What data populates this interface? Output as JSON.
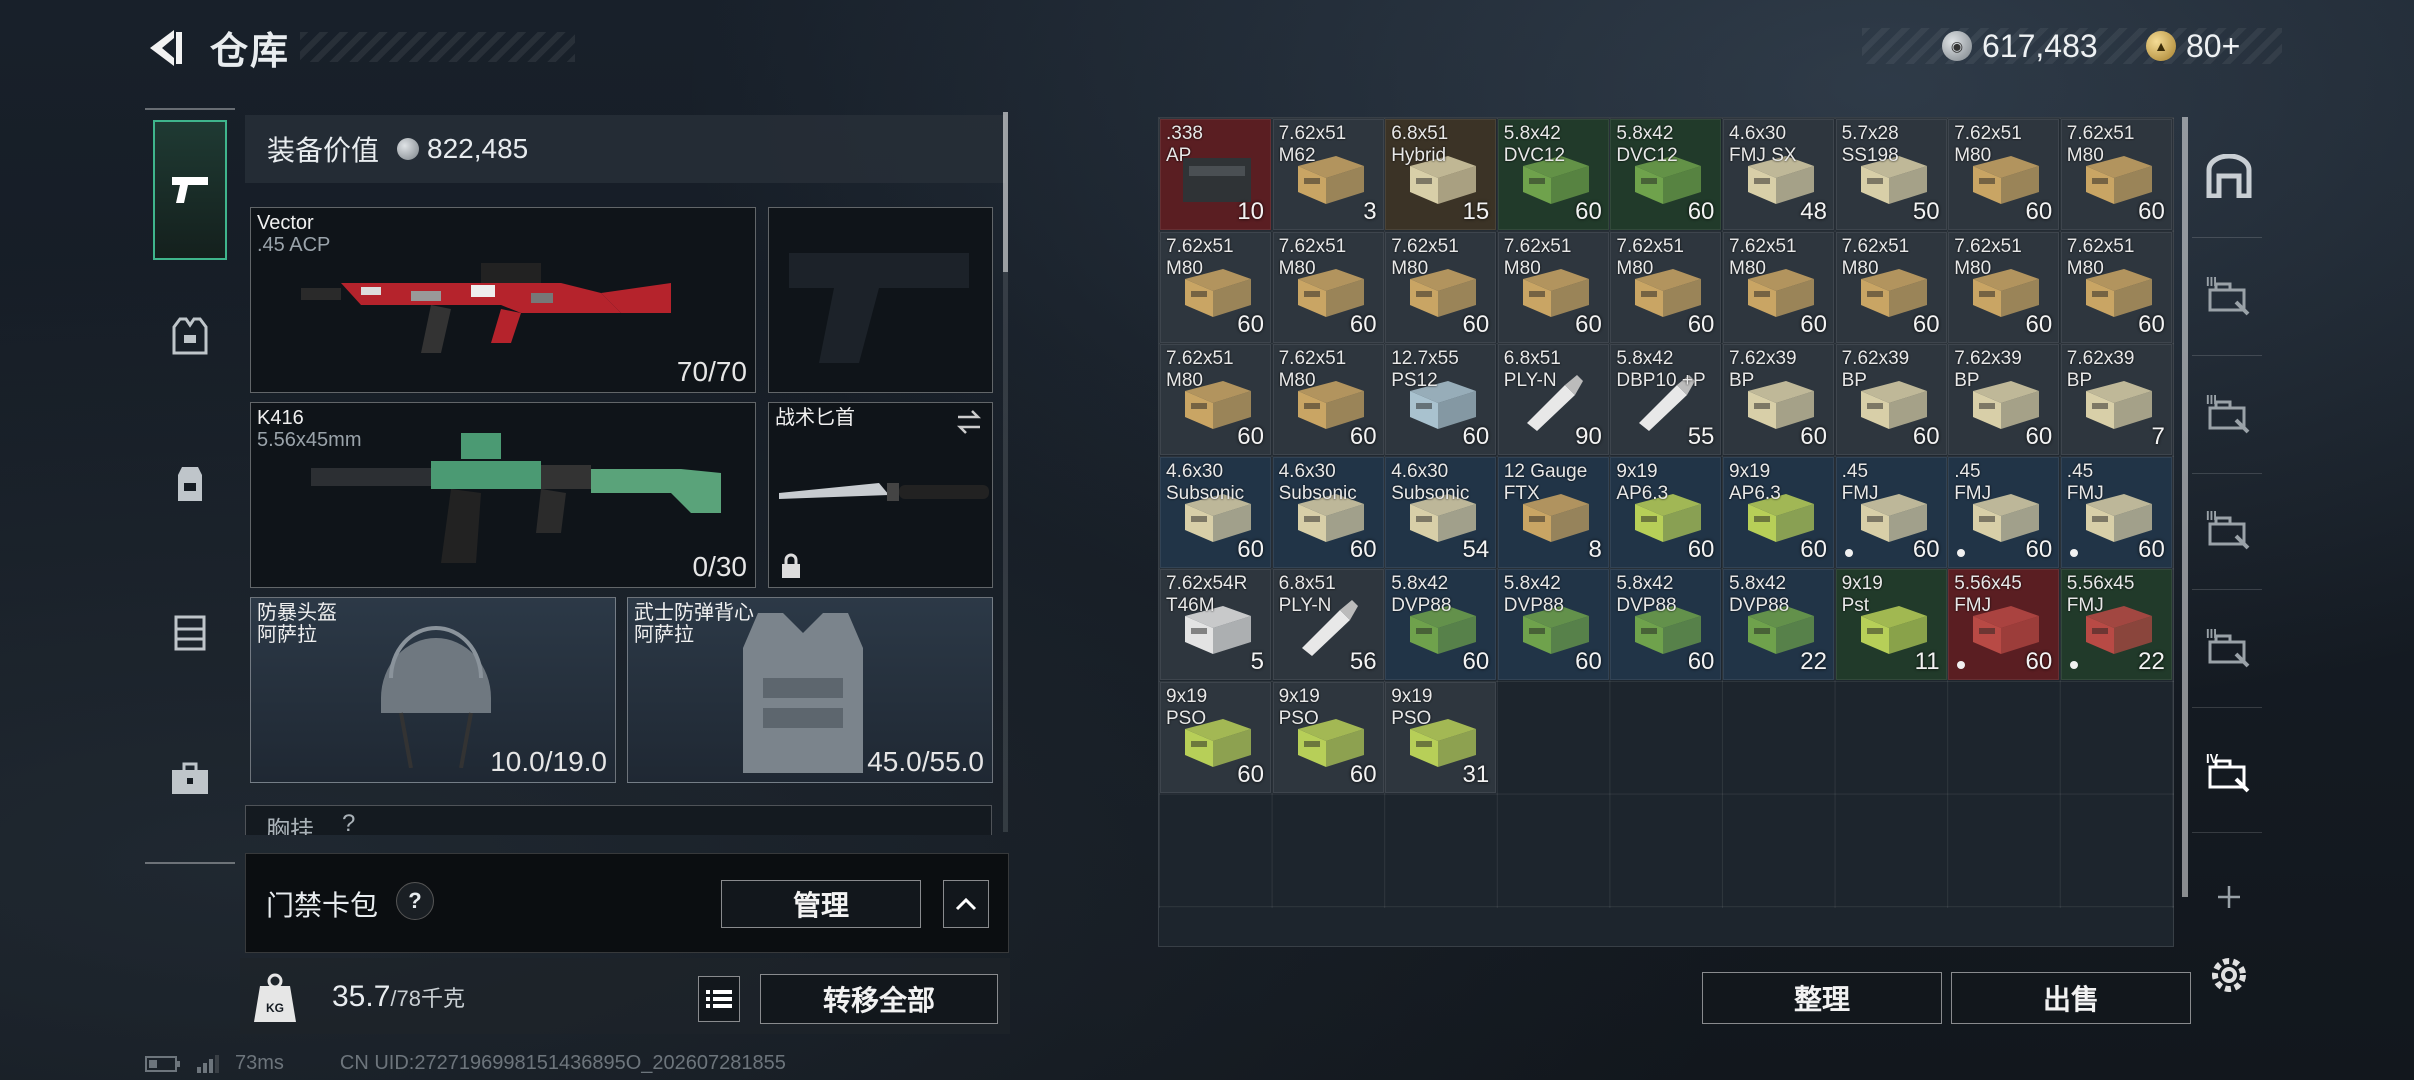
{
  "header": {
    "title": "仓库",
    "currency_silver": "617,483",
    "currency_gold": "80+"
  },
  "loadout": {
    "equip_value_label": "装备价值",
    "equip_value": "822,485",
    "primary": {
      "name": "Vector",
      "caliber": ".45 ACP",
      "ammo": "70/70"
    },
    "secondary": {
      "name": "K416",
      "caliber": "5.56x45mm",
      "ammo": "0/30"
    },
    "melee": {
      "name": "战术匕首"
    },
    "helmet": {
      "name": "防暴头盔",
      "sub": "阿萨拉",
      "durability": "10.0/19.0"
    },
    "vest": {
      "name": "武士防弹背心",
      "sub": "阿萨拉",
      "durability": "45.0/55.0"
    },
    "chest_rig_label": "胸挂",
    "chest_rig_badge": "?"
  },
  "keycard": {
    "label": "门禁卡包",
    "help": "?",
    "manage": "管理"
  },
  "bottom": {
    "weight_icon": "KG",
    "weight": "35.7",
    "weight_max": "/78千克",
    "transfer_all": "转移全部",
    "sort": "整理",
    "sell": "出售"
  },
  "status": {
    "ping": "73ms",
    "uid": "CN UID:2727196998151436895O_202607281855"
  },
  "colors": {
    "accent_green": "#3fb58c",
    "cell_red": "#5a1e22",
    "cell_green": "#1f3a2a",
    "cell_blue": "#1f3346",
    "cell_gray": "#2e363e"
  },
  "stash": [
    {
      "cal": ".338",
      "sub": "AP",
      "qty": "10",
      "bg": "red",
      "box": "black"
    },
    {
      "cal": "7.62x51",
      "sub": "M62",
      "qty": "3",
      "bg": "gray",
      "box": "tan"
    },
    {
      "cal": "6.8x51",
      "sub": "Hybrid",
      "qty": "15",
      "bg": "brown",
      "box": "cream"
    },
    {
      "cal": "5.8x42",
      "sub": "DVC12",
      "qty": "60",
      "bg": "green",
      "box": "green"
    },
    {
      "cal": "5.8x42",
      "sub": "DVC12",
      "qty": "60",
      "bg": "green",
      "box": "green"
    },
    {
      "cal": "4.6x30",
      "sub": "FMJ SX",
      "qty": "48",
      "bg": "gray",
      "box": "cream"
    },
    {
      "cal": "5.7x28",
      "sub": "SS198",
      "qty": "50",
      "bg": "gray",
      "box": "cream"
    },
    {
      "cal": "7.62x51",
      "sub": "M80",
      "qty": "60",
      "bg": "gray",
      "box": "tan"
    },
    {
      "cal": "7.62x51",
      "sub": "M80",
      "qty": "60",
      "bg": "gray",
      "box": "tan"
    },
    {
      "cal": "7.62x51",
      "sub": "M80",
      "qty": "60",
      "bg": "gray",
      "box": "tan"
    },
    {
      "cal": "7.62x51",
      "sub": "M80",
      "qty": "60",
      "bg": "gray",
      "box": "tan"
    },
    {
      "cal": "7.62x51",
      "sub": "M80",
      "qty": "60",
      "bg": "gray",
      "box": "tan"
    },
    {
      "cal": "7.62x51",
      "sub": "M80",
      "qty": "60",
      "bg": "gray",
      "box": "tan"
    },
    {
      "cal": "7.62x51",
      "sub": "M80",
      "qty": "60",
      "bg": "gray",
      "box": "tan"
    },
    {
      "cal": "7.62x51",
      "sub": "M80",
      "qty": "60",
      "bg": "gray",
      "box": "tan"
    },
    {
      "cal": "7.62x51",
      "sub": "M80",
      "qty": "60",
      "bg": "gray",
      "box": "tan"
    },
    {
      "cal": "7.62x51",
      "sub": "M80",
      "qty": "60",
      "bg": "gray",
      "box": "tan"
    },
    {
      "cal": "7.62x51",
      "sub": "M80",
      "qty": "60",
      "bg": "gray",
      "box": "tan"
    },
    {
      "cal": "7.62x51",
      "sub": "M80",
      "qty": "60",
      "bg": "gray",
      "box": "tan"
    },
    {
      "cal": "7.62x51",
      "sub": "M80",
      "qty": "60",
      "bg": "gray",
      "box": "tan"
    },
    {
      "cal": "12.7x55",
      "sub": "PS12",
      "qty": "60",
      "bg": "gray",
      "box": "blue"
    },
    {
      "cal": "6.8x51",
      "sub": "PLY-N",
      "qty": "90",
      "bg": "gray",
      "box": "round"
    },
    {
      "cal": "5.8x42",
      "sub": "DBP10 +P",
      "qty": "55",
      "bg": "gray",
      "box": "round"
    },
    {
      "cal": "7.62x39",
      "sub": "BP",
      "qty": "60",
      "bg": "gray",
      "box": "cream"
    },
    {
      "cal": "7.62x39",
      "sub": "BP",
      "qty": "60",
      "bg": "gray",
      "box": "cream"
    },
    {
      "cal": "7.62x39",
      "sub": "BP",
      "qty": "60",
      "bg": "gray",
      "box": "cream"
    },
    {
      "cal": "7.62x39",
      "sub": "BP",
      "qty": "7",
      "bg": "gray",
      "box": "cream"
    },
    {
      "cal": "4.6x30",
      "sub": "Subsonic",
      "qty": "60",
      "bg": "blue",
      "box": "cream"
    },
    {
      "cal": "4.6x30",
      "sub": "Subsonic",
      "qty": "60",
      "bg": "blue",
      "box": "cream"
    },
    {
      "cal": "4.6x30",
      "sub": "Subsonic",
      "qty": "54",
      "bg": "blue",
      "box": "cream"
    },
    {
      "cal": "12 Gauge",
      "sub": "FTX",
      "qty": "8",
      "bg": "blue",
      "box": "tan"
    },
    {
      "cal": "9x19",
      "sub": "AP6.3",
      "qty": "60",
      "bg": "blue",
      "box": "lime"
    },
    {
      "cal": "9x19",
      "sub": "AP6.3",
      "qty": "60",
      "bg": "blue",
      "box": "lime"
    },
    {
      "cal": ".45",
      "sub": "FMJ",
      "qty": "60",
      "bg": "blue",
      "box": "cream",
      "dot": true
    },
    {
      "cal": ".45",
      "sub": "FMJ",
      "qty": "60",
      "bg": "blue",
      "box": "cream",
      "dot": true
    },
    {
      "cal": ".45",
      "sub": "FMJ",
      "qty": "60",
      "bg": "blue",
      "box": "cream",
      "dot": true
    },
    {
      "cal": "7.62x54R",
      "sub": "T46M",
      "qty": "5",
      "bg": "gray",
      "box": "white"
    },
    {
      "cal": "6.8x51",
      "sub": "PLY-N",
      "qty": "56",
      "bg": "gray",
      "box": "round"
    },
    {
      "cal": "5.8x42",
      "sub": "DVP88",
      "qty": "60",
      "bg": "blue",
      "box": "green"
    },
    {
      "cal": "5.8x42",
      "sub": "DVP88",
      "qty": "60",
      "bg": "blue",
      "box": "green"
    },
    {
      "cal": "5.8x42",
      "sub": "DVP88",
      "qty": "60",
      "bg": "blue",
      "box": "green"
    },
    {
      "cal": "5.8x42",
      "sub": "DVP88",
      "qty": "22",
      "bg": "blue",
      "box": "green"
    },
    {
      "cal": "9x19",
      "sub": "Pst",
      "qty": "11",
      "bg": "green",
      "box": "lime"
    },
    {
      "cal": "5.56x45",
      "sub": "FMJ",
      "qty": "60",
      "bg": "red",
      "box": "red",
      "dot": true
    },
    {
      "cal": "5.56x45",
      "sub": "FMJ",
      "qty": "22",
      "bg": "green",
      "box": "red",
      "dot": true
    },
    {
      "cal": "9x19",
      "sub": "PSO",
      "qty": "60",
      "bg": "gray",
      "box": "lime"
    },
    {
      "cal": "9x19",
      "sub": "PSO",
      "qty": "60",
      "bg": "gray",
      "box": "lime"
    },
    {
      "cal": "9x19",
      "sub": "PSO",
      "qty": "31",
      "bg": "gray",
      "box": "lime"
    }
  ],
  "right_tabs": [
    {
      "icon": "safe-box-icon"
    },
    {
      "icon": "case-level-3-icon",
      "label": "III"
    },
    {
      "icon": "case-level-3-icon",
      "label": "III"
    },
    {
      "icon": "case-level-3-icon",
      "label": "III"
    },
    {
      "icon": "case-level-3-icon",
      "label": "III"
    },
    {
      "icon": "case-level-4-icon",
      "label": "IV"
    },
    {
      "icon": "add-icon",
      "label": "+"
    }
  ]
}
